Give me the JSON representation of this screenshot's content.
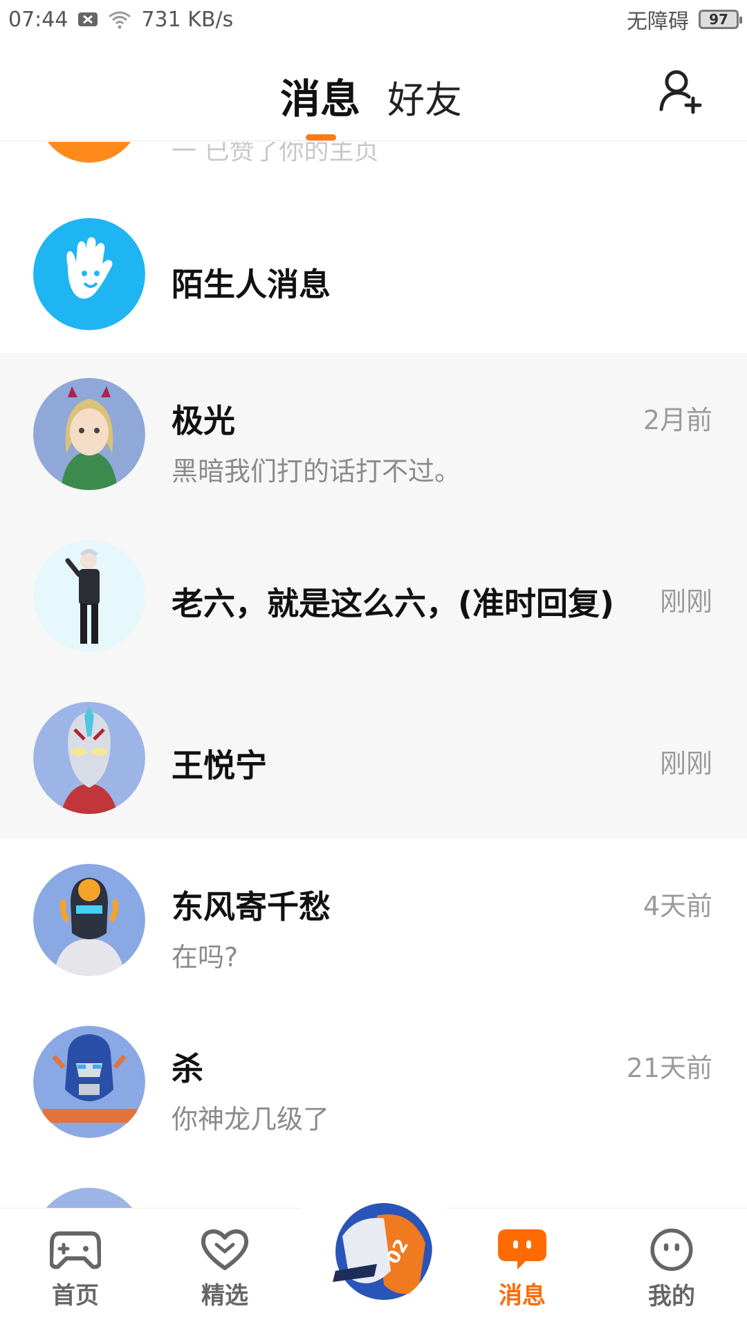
{
  "status_bar": {
    "time": "07:44",
    "speed": "731 KB/s",
    "accessibility": "无障碍",
    "battery": "97"
  },
  "header": {
    "tab_messages": "消息",
    "tab_friends": "好友",
    "active_tab": "消息",
    "accent_color": "#ff7a14"
  },
  "partial_row": {
    "preview": "一 已赞了你的主页"
  },
  "stranger_row": {
    "name": "陌生人消息"
  },
  "conversations": [
    {
      "name": "极光",
      "preview": "黑暗我们打的话打不过。",
      "time": "2月前"
    },
    {
      "name": "老六，就是这么六，(准时回复)",
      "preview": "",
      "time": "刚刚"
    },
    {
      "name": "王悦宁",
      "preview": "",
      "time": "刚刚"
    },
    {
      "name": "东风寄千愁",
      "preview": "在吗?",
      "time": "4天前"
    },
    {
      "name": "杀",
      "preview": "你神龙几级了",
      "time": "21天前"
    }
  ],
  "bottom_nav": {
    "home": "首页",
    "featured": "精选",
    "messages": "消息",
    "mine": "我的"
  },
  "icons": {
    "add_friend": "add-friend-icon",
    "home": "gamepad-icon",
    "featured": "heart-icon",
    "messages": "chat-bubble-icon",
    "mine": "face-icon"
  }
}
